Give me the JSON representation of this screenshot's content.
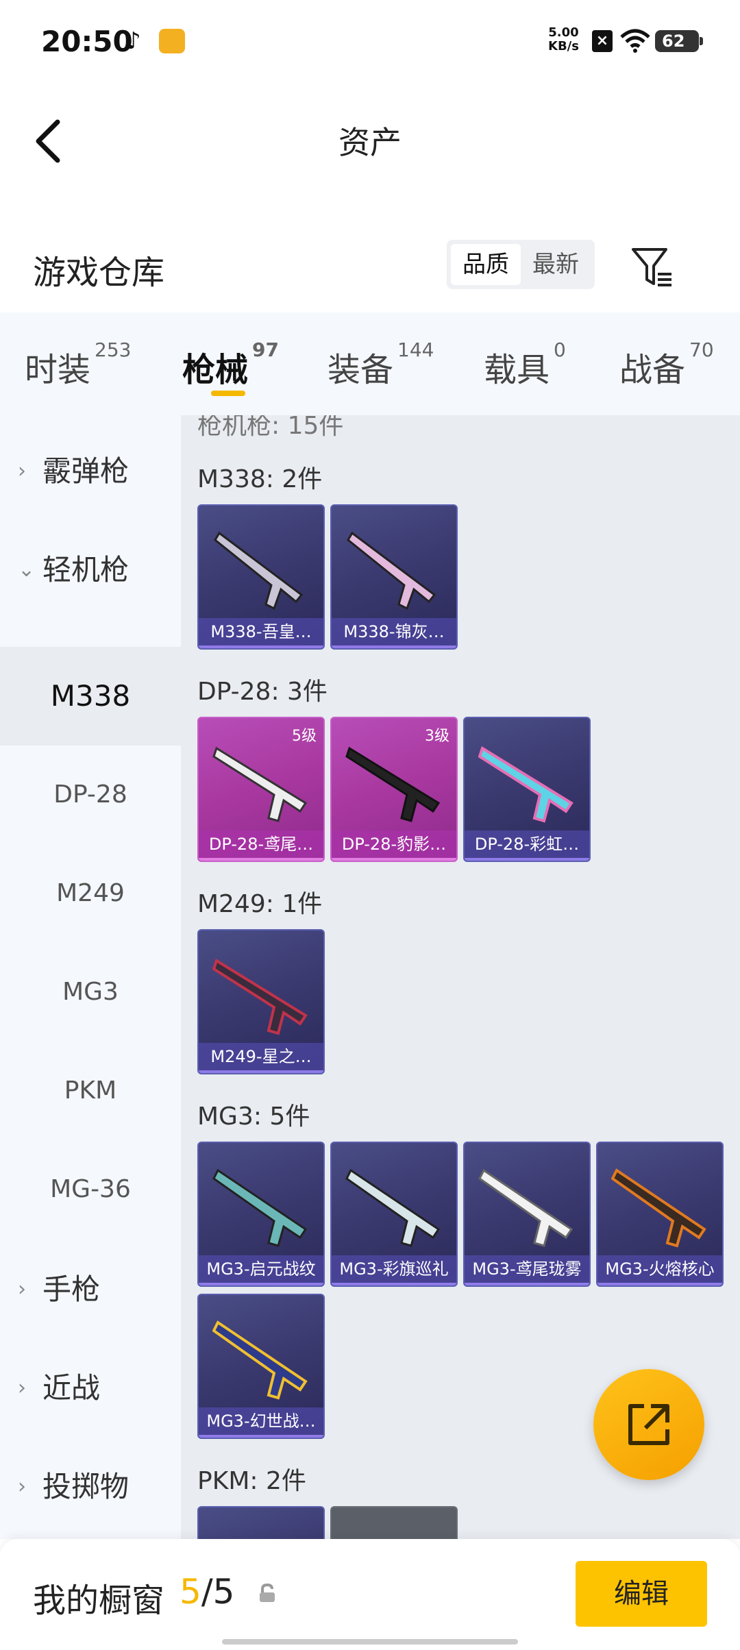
{
  "status": {
    "time": "20:50",
    "net_speed_top": "5.00",
    "net_speed_unit": "KB/s",
    "battery": "62"
  },
  "header": {
    "title": "资产"
  },
  "warehouse": {
    "title": "游戏仓库",
    "sort_quality": "品质",
    "sort_newest": "最新"
  },
  "tabs": [
    {
      "label": "时装",
      "count": "253"
    },
    {
      "label": "枪械",
      "count": "97"
    },
    {
      "label": "装备",
      "count": "144"
    },
    {
      "label": "载具",
      "count": "0"
    },
    {
      "label": "战备",
      "count": "70"
    }
  ],
  "sidebar": {
    "cut_top": "",
    "items": [
      {
        "label": "霰弹枪"
      },
      {
        "label": "轻机枪"
      }
    ],
    "subitems": [
      "M338",
      "DP-28",
      "M249",
      "MG3",
      "PKM",
      "MG-36"
    ],
    "lower_items": [
      {
        "label": "手枪"
      },
      {
        "label": "近战"
      },
      {
        "label": "投掷物"
      }
    ]
  },
  "content": {
    "cut_top": "枪机枪: 15件",
    "sections": [
      {
        "title": "M338: 2件",
        "cards": [
          {
            "name": "M338-吾皇…",
            "level": ""
          },
          {
            "name": "M338-锦灰…",
            "level": ""
          }
        ]
      },
      {
        "title": "DP-28: 3件",
        "cards": [
          {
            "name": "DP-28-鸢尾…",
            "level": "5级"
          },
          {
            "name": "DP-28-豹影…",
            "level": "3级"
          },
          {
            "name": "DP-28-彩虹…",
            "level": ""
          }
        ]
      },
      {
        "title": "M249: 1件",
        "cards": [
          {
            "name": "M249-星之…",
            "level": ""
          }
        ]
      },
      {
        "title": "MG3: 5件",
        "cards": [
          {
            "name": "MG3-启元战纹",
            "level": ""
          },
          {
            "name": "MG3-彩旗巡礼",
            "level": ""
          },
          {
            "name": "MG3-鸢尾珑雾",
            "level": ""
          },
          {
            "name": "MG3-火熔核心",
            "level": ""
          },
          {
            "name": "MG3-幻世战…",
            "level": ""
          }
        ]
      },
      {
        "title": "PKM: 2件",
        "cards": []
      }
    ]
  },
  "bottom": {
    "label": "我的橱窗",
    "count_current": "5",
    "count_total": "/5",
    "edit_label": "编辑"
  },
  "colors": {
    "accent": "#f5b800",
    "card_purple": "#3b3a70",
    "card_pink": "#a8389f"
  }
}
